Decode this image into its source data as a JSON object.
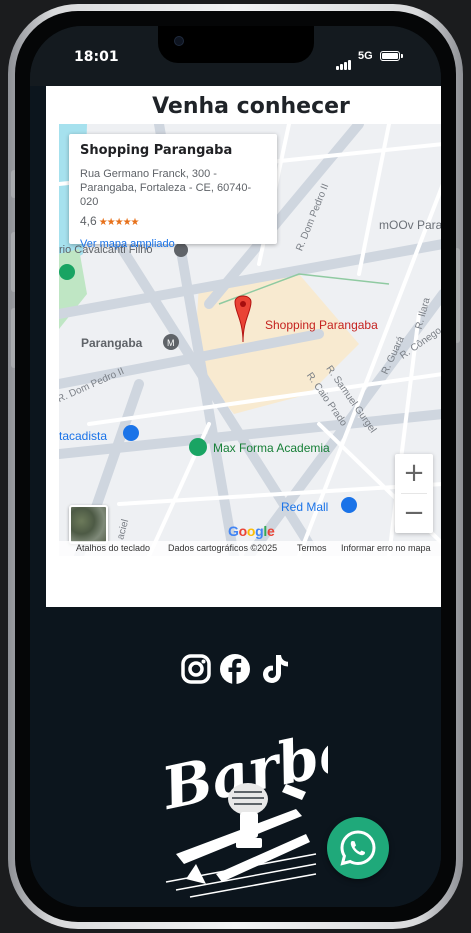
{
  "status_bar": {
    "time": "18:01",
    "network": "5G"
  },
  "section": {
    "heading": "Venha conhecer"
  },
  "map": {
    "info_card": {
      "title": "Shopping Parangaba",
      "address_line1": "Rua Germano Franck, 300 -",
      "address_line2": "Parangaba, Fortaleza - CE, 60740-020",
      "rating": "4,6",
      "stars": "★★★★★",
      "link": "Ver mapa ampliado"
    },
    "labels": {
      "marker": "Shopping Parangaba",
      "parangaba": "Parangaba",
      "dom_pedro_top": "R. Dom Pedro II",
      "dom_pedro_left": "R. Dom Pedro II",
      "cavalcanti": "rio Cavalcanti Filho",
      "moov": "mOOv Para",
      "atacadista": "tacadista",
      "max_forma": "Max Forma Academia",
      "red_mall": "Red Mall",
      "samuel": "R. Samuel Gurgel",
      "caio": "R. Caio Prado",
      "guara": "R. Guará",
      "conego": "R. Cônego",
      "lara": "R. Ilara",
      "maciel": "aciel"
    },
    "zoom_in": "+",
    "zoom_out": "−",
    "google_logo": [
      "G",
      "o",
      "o",
      "g",
      "l",
      "e"
    ],
    "attribution": {
      "shortcuts": "Atalhos do teclado",
      "data": "Dados cartográficos ©2025",
      "terms": "Termos",
      "report": "Informar erro no mapa"
    }
  },
  "footer": {
    "social_icons": [
      "instagram-icon",
      "facebook-icon",
      "tiktok-icon"
    ],
    "logo_text": "Barber"
  },
  "colors": {
    "footer_bg": "#0c151d",
    "marker_red": "#c5221f",
    "whatsapp_green": "#1fa97a",
    "link_blue": "#1a73e8"
  }
}
